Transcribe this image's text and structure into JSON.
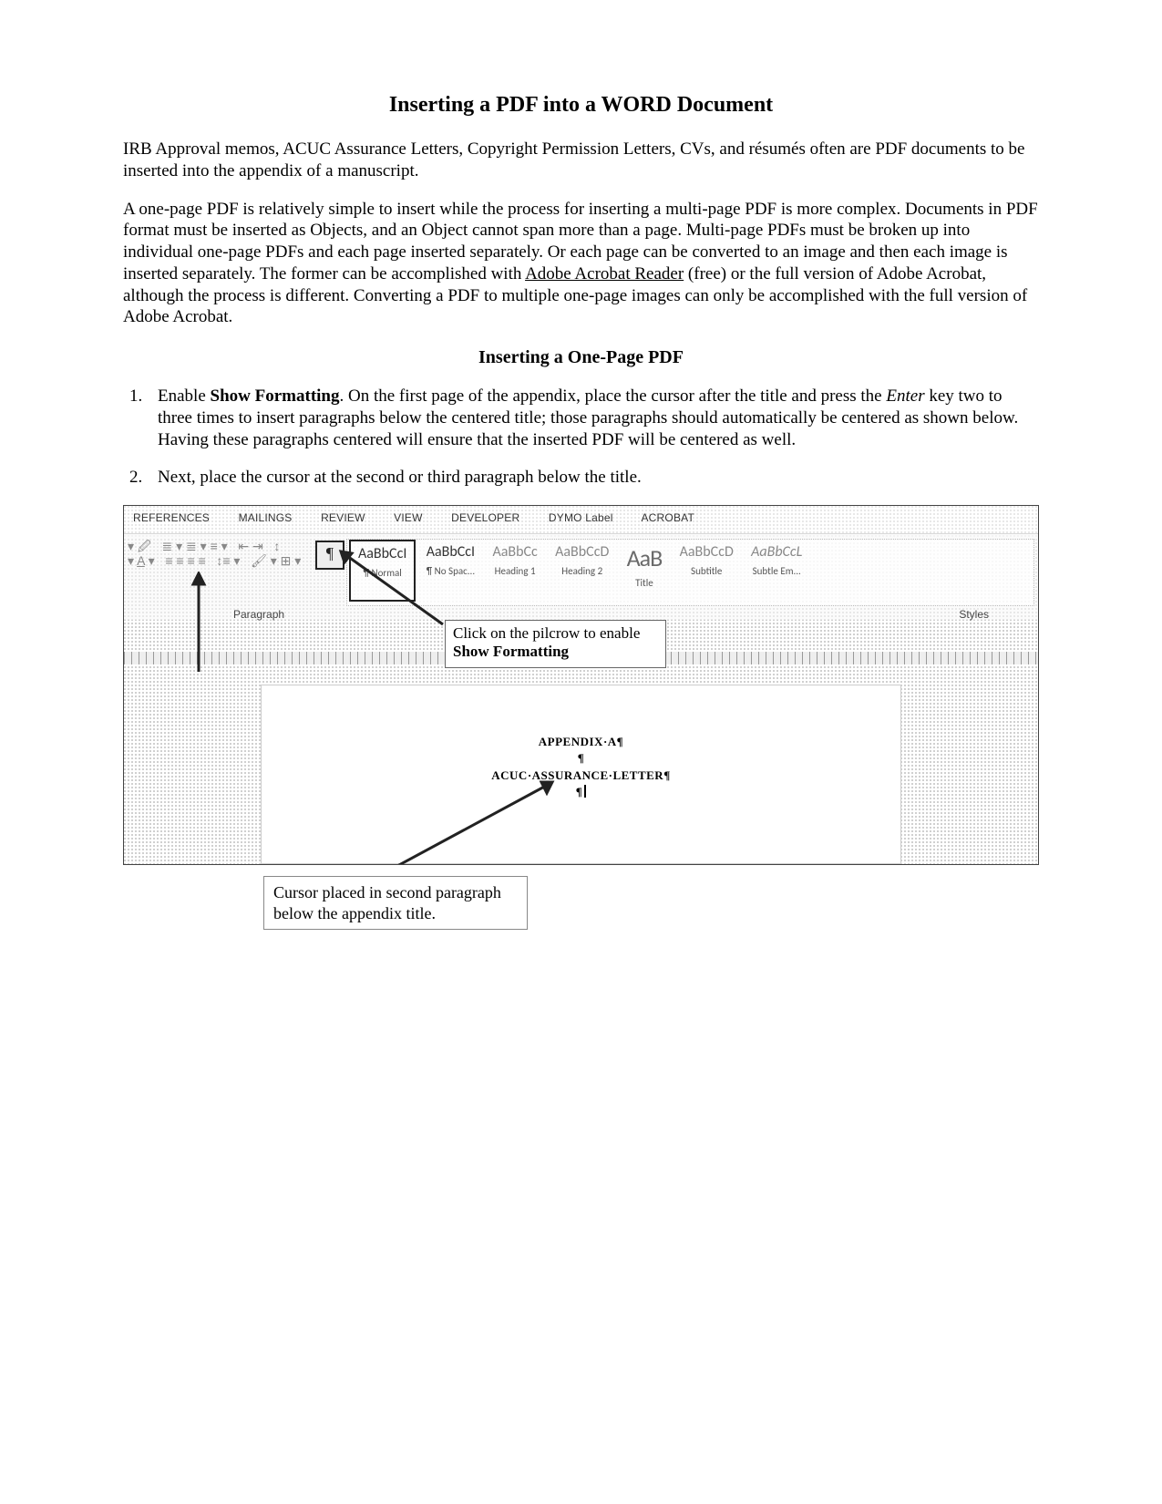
{
  "title": "Inserting a PDF into a WORD Document",
  "intro1": "IRB Approval memos, ACUC Assurance Letters, Copyright Permission Letters, CVs, and résumés often are PDF documents to be inserted into the appendix of a manuscript.",
  "intro2a": "A one-page PDF is relatively simple to insert while the process for inserting a multi-page PDF is more complex. Documents in PDF format must be inserted as Objects, and an Object cannot span more than a page. Multi-page PDFs must be broken up into individual one-page PDFs and each page inserted separately. Or each page can be converted to an image and then each image is inserted separately. The former can be accomplished with ",
  "intro2_link": "Adobe Acrobat Reader",
  "intro2b": " (free) or the full version of Adobe Acrobat, although the process is different. Converting a PDF to multiple one-page images can only be accomplished with the full version of Adobe Acrobat.",
  "subheading": "Inserting a One-Page PDF",
  "step1_a": "Enable ",
  "step1_bold": "Show Formatting",
  "step1_b": ". On the first page of the appendix, place the cursor after the title and press the ",
  "step1_italic": "Enter",
  "step1_c": " key two to three times to insert paragraphs below the centered title; those paragraphs should automatically be centered as shown below. Having these paragraphs centered will ensure that the inserted PDF will be centered as well.",
  "step2": "Next, place the cursor at the second or third paragraph below the title.",
  "tabs": {
    "references": "REFERENCES",
    "mailings": "MAILINGS",
    "review": "REVIEW",
    "view": "VIEW",
    "developer": "DEVELOPER",
    "dymo": "DYMO Label",
    "acrobat": "ACROBAT"
  },
  "ribbon": {
    "paragraph_label": "Paragraph",
    "styles_label": "Styles",
    "pilcrow": "¶",
    "styles": [
      {
        "preview": "AaBbCcI",
        "label": "¶ Normal"
      },
      {
        "preview": "AaBbCcI",
        "label": "¶ No Spac..."
      },
      {
        "preview": "AaBbCc",
        "label": "Heading 1"
      },
      {
        "preview": "AaBbCcD",
        "label": "Heading 2"
      },
      {
        "preview": "AaB",
        "label": "Title"
      },
      {
        "preview": "AaBbCcD",
        "label": "Subtitle"
      },
      {
        "preview": "AaBbCcL",
        "label": "Subtle Em..."
      }
    ]
  },
  "callout1_a": "Click on the pilcrow to enable ",
  "callout1_b": "Show Formatting",
  "doc": {
    "line1": "APPENDIX·A¶",
    "line2": "¶",
    "line3": "ACUC·ASSURANCE·LETTER¶",
    "line4": "¶"
  },
  "callout2": "Cursor placed in second paragraph below the appendix title."
}
